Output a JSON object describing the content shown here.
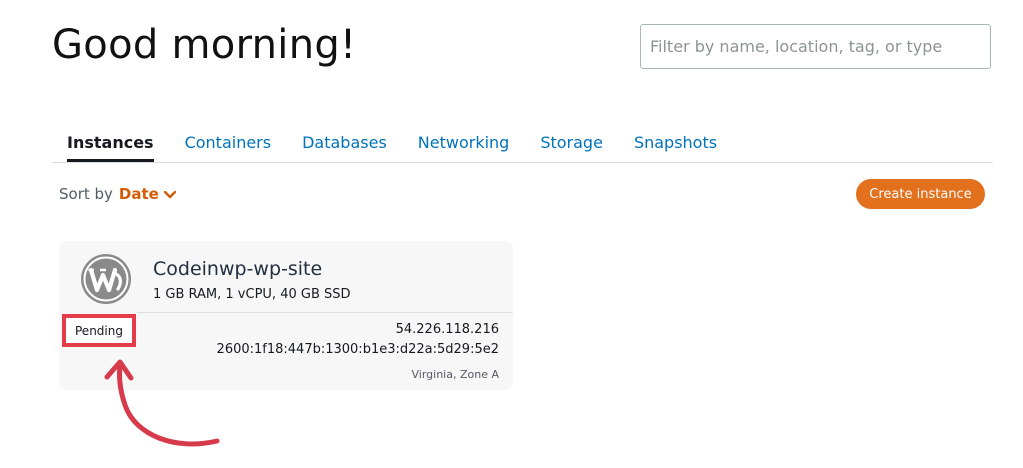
{
  "header": {
    "greeting": "Good morning!",
    "search_placeholder": "Filter by name, location, tag, or type"
  },
  "tabs": [
    {
      "label": "Instances",
      "active": true
    },
    {
      "label": "Containers",
      "active": false
    },
    {
      "label": "Databases",
      "active": false
    },
    {
      "label": "Networking",
      "active": false
    },
    {
      "label": "Storage",
      "active": false
    },
    {
      "label": "Snapshots",
      "active": false
    }
  ],
  "sort": {
    "label": "Sort by",
    "value": "Date",
    "icon": "chevron-down-icon"
  },
  "create_button": {
    "label": "Create instance"
  },
  "instance": {
    "icon": "wordpress-icon",
    "name": "Codeinwp-wp-site",
    "specs": "1 GB RAM, 1 vCPU, 40 GB SSD",
    "status": "Pending",
    "ipv4": "54.226.118.216",
    "ipv6": "2600:1f18:447b:1300:b1e3:d22a:5d29:5e2",
    "zone": "Virginia, Zone A"
  },
  "annotation": {
    "highlight_color": "#e53c4a",
    "arrow_icon": "curved-arrow-annotation"
  },
  "colors": {
    "accent": "#e2701d",
    "link": "#0073bb",
    "sort_value": "#d45b07"
  }
}
